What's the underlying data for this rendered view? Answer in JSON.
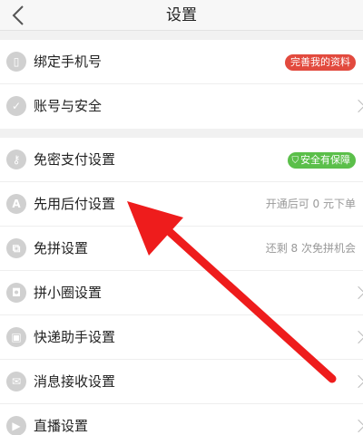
{
  "header": {
    "title": "设置"
  },
  "section1": [
    {
      "name": "bind-phone",
      "icon": "phone-icon",
      "icon_glyph": "▯",
      "label": "绑定手机号",
      "badge": "完善我的资料",
      "badge_color": "#e24a3e"
    },
    {
      "name": "account-security",
      "icon": "shield-check-icon",
      "icon_glyph": "✓",
      "label": "账号与安全"
    }
  ],
  "section2": [
    {
      "name": "password-free-payment",
      "icon": "key-icon",
      "icon_glyph": "⚷",
      "label": "免密支付设置",
      "badge": "安全有保障",
      "badge_color": "#5bbf4a"
    },
    {
      "name": "pay-later",
      "icon": "pay-later-icon",
      "icon_glyph": "A",
      "label": "先用后付设置",
      "hint": "开通后可 0 元下单"
    },
    {
      "name": "free-group",
      "icon": "group-icon",
      "icon_glyph": "⧉",
      "label": "免拼设置",
      "hint": "还剩 8 次免拼机会"
    },
    {
      "name": "small-circle",
      "icon": "lock-icon",
      "icon_glyph": "◘",
      "label": "拼小圈设置"
    },
    {
      "name": "delivery-assistant",
      "icon": "package-icon",
      "icon_glyph": "▣",
      "label": "快递助手设置"
    },
    {
      "name": "message-receive",
      "icon": "mail-icon",
      "icon_glyph": "✉",
      "label": "消息接收设置"
    },
    {
      "name": "live-stream",
      "icon": "video-camera-icon",
      "icon_glyph": "▶",
      "label": "直播设置"
    }
  ]
}
